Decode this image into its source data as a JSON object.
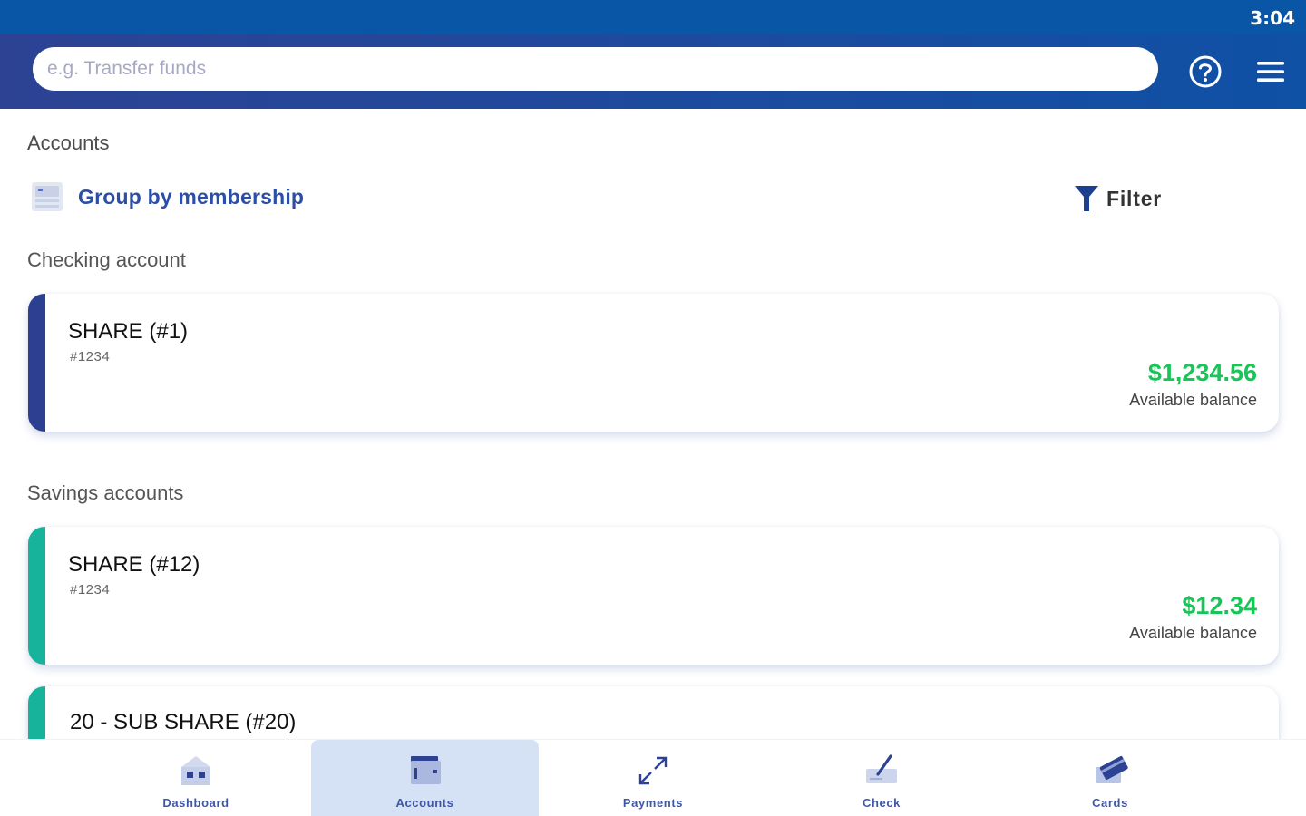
{
  "status_bar": {
    "time": "3:04"
  },
  "search": {
    "placeholder": "e.g. Transfer funds"
  },
  "page": {
    "title": "Accounts"
  },
  "toolbar": {
    "group_label": "Group by membership",
    "filter_label": "Filter"
  },
  "sections": {
    "checking": {
      "title": "Checking account"
    },
    "savings": {
      "title": "Savings accounts"
    }
  },
  "accounts": [
    {
      "name": "SHARE (#1)",
      "number": "#1234",
      "balance": "$1,234.56",
      "balance_label": "Available balance",
      "stripe_color": "#2d3f91"
    },
    {
      "name": "SHARE (#12)",
      "number": "#1234",
      "balance": "$12.34",
      "balance_label": "Available balance",
      "stripe_color": "#17b39a"
    },
    {
      "name": "20 - SUB SHARE (#20)",
      "stripe_color": "#17b39a"
    }
  ],
  "nav": {
    "dashboard": "Dashboard",
    "accounts": "Accounts",
    "payments": "Payments",
    "check": "Check",
    "cards": "Cards"
  },
  "colors": {
    "status_bar": "#0a56a6",
    "app_bar": "#1e4a9e",
    "accent": "#2b4ea6",
    "balance": "#19c459",
    "nav_active_bg": "#d5e1f5"
  }
}
